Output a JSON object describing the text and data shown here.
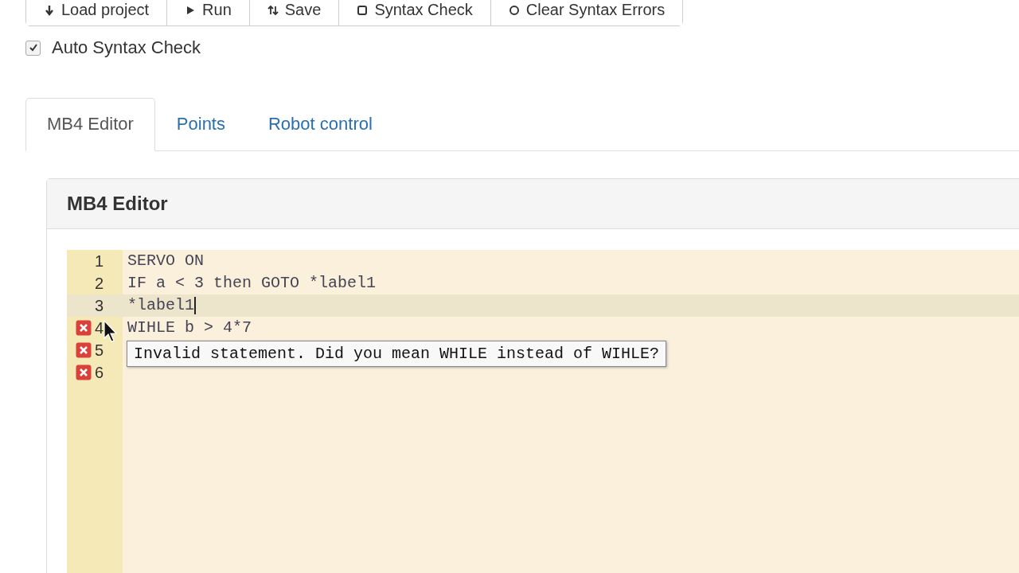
{
  "toolbar": {
    "buttons": [
      {
        "label": "Load project",
        "kind": "load"
      },
      {
        "label": "Run",
        "kind": "run"
      },
      {
        "label": "Save",
        "kind": "save"
      },
      {
        "label": "Syntax Check",
        "kind": "check"
      },
      {
        "label": "Clear Syntax Errors",
        "kind": "clear"
      }
    ]
  },
  "auto_syntax_check": {
    "label": "Auto Syntax Check",
    "checked": true
  },
  "tabs": [
    {
      "label": "MB4 Editor",
      "selected": true
    },
    {
      "label": "Points",
      "selected": false
    },
    {
      "label": "Robot control",
      "selected": false
    }
  ],
  "panel": {
    "title": "MB4 Editor"
  },
  "editor": {
    "lines": [
      {
        "number": "1",
        "code": "SERVO ON",
        "error": false,
        "active": false
      },
      {
        "number": "2",
        "code": "IF a < 3 then GOTO *label1",
        "error": false,
        "active": false
      },
      {
        "number": "3",
        "code": "*label1",
        "error": false,
        "active": true
      },
      {
        "number": "4",
        "code": "WIHLE b > 4*7",
        "error": true,
        "active": false
      },
      {
        "number": "5",
        "error": true,
        "active": false
      },
      {
        "number": "6",
        "error": true,
        "active": false
      }
    ]
  },
  "tooltip": {
    "text": "Invalid statement. Did you mean WHILE instead of WIHLE?"
  }
}
